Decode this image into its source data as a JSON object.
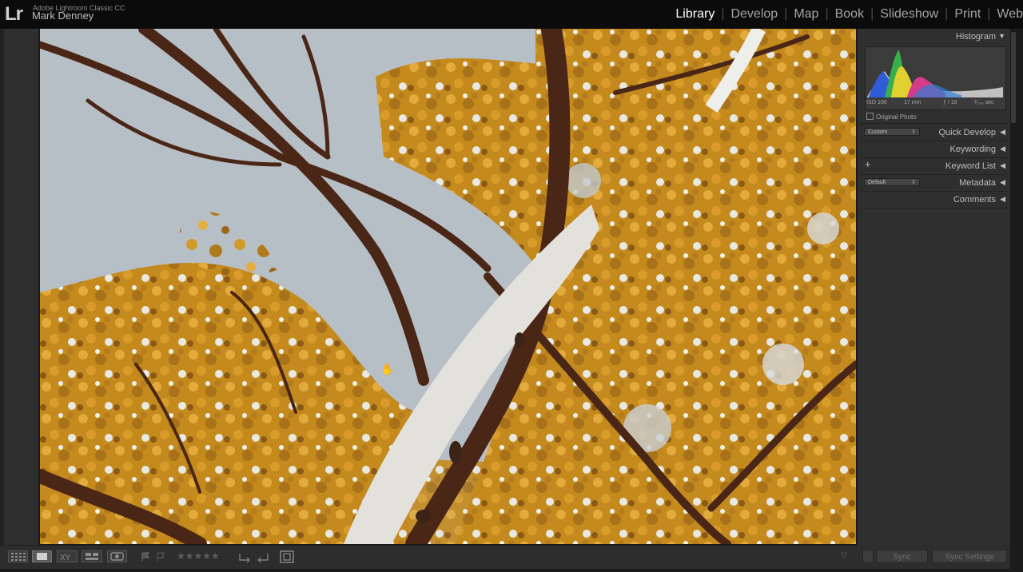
{
  "app": {
    "logo": "Lr",
    "app_name": "Adobe Lightroom Classic CC",
    "user_name": "Mark Denney"
  },
  "modules": [
    {
      "label": "Library",
      "active": true
    },
    {
      "label": "Develop",
      "active": false
    },
    {
      "label": "Map",
      "active": false
    },
    {
      "label": "Book",
      "active": false
    },
    {
      "label": "Slideshow",
      "active": false
    },
    {
      "label": "Print",
      "active": false
    },
    {
      "label": "Web",
      "active": false
    }
  ],
  "separator": "|",
  "right_panel": {
    "histogram": {
      "title": "Histogram",
      "iso": "ISO 100",
      "focal": "17 mm",
      "aperture": "ƒ / 16",
      "shutter": "¹⁄₁₀₀ sec",
      "original_photo_label": "Original Photo"
    },
    "quick_develop": {
      "title": "Quick Develop",
      "preset": "Custom"
    },
    "keywording": {
      "title": "Keywording"
    },
    "keyword_list": {
      "title": "Keyword List",
      "add": "+"
    },
    "metadata": {
      "title": "Metadata",
      "preset": "Default"
    },
    "comments": {
      "title": "Comments"
    }
  },
  "toolbar": {
    "stars": "★★★★★",
    "sync_label": "Sync",
    "sync_settings_label": "Sync Settings"
  },
  "icons": {
    "grid_view": "grid-icon",
    "loupe_view": "loupe-icon",
    "compare_view": "compare-icon",
    "survey_view": "survey-icon",
    "people_view": "people-icon",
    "flag_pick": "flag-icon",
    "flag_reject": "flag-reject-icon",
    "rotate_left": "rotate-left-icon",
    "rotate_right": "rotate-right-icon",
    "crop_zoom": "zoom-frame-icon",
    "panel_collapse": "triangle-left-icon",
    "panel_expand": "triangle-down-icon",
    "pan_cursor": "hand-cursor-icon"
  }
}
